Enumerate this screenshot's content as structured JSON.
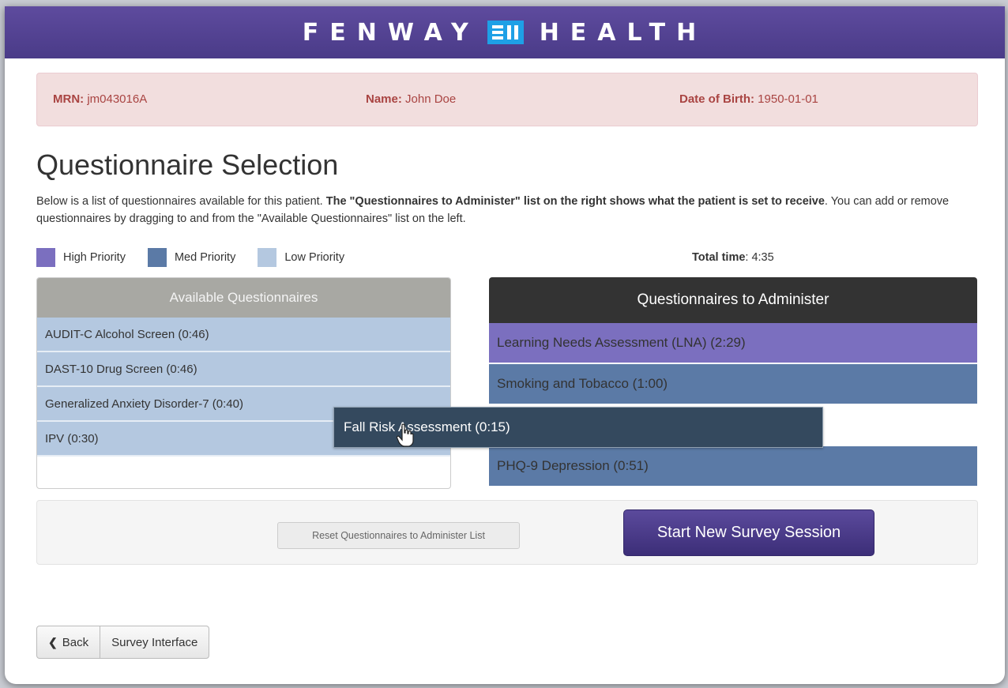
{
  "header": {
    "logo_left": "FENWAY",
    "logo_right": "HEALTH"
  },
  "patient": {
    "mrn_label": "MRN:",
    "mrn_value": "jm043016A",
    "name_label": "Name:",
    "name_value": "John Doe",
    "dob_label": "Date of Birth:",
    "dob_value": "1950-01-01"
  },
  "page": {
    "title": "Questionnaire Selection",
    "desc_1": "Below is a list of questionnaires available for this patient. ",
    "desc_bold": "The \"Questionnaires to Administer\" list on the right shows what the patient is set to receive",
    "desc_2": ". You can add or remove questionnaires by dragging to and from the \"Available Questionnaires\" list on the left."
  },
  "legend": {
    "high": "High Priority",
    "med": "Med Priority",
    "low": "Low Priority",
    "colors": {
      "high": "#7b6fbf",
      "med": "#5b7aa6",
      "low": "#b4c8e0"
    }
  },
  "total_time": {
    "label": "Total time",
    "value": ": 4:35"
  },
  "available": {
    "title": "Available Questionnaires",
    "items": [
      "AUDIT-C Alcohol Screen (0:46)",
      "DAST-10 Drug Screen (0:46)",
      "Generalized Anxiety Disorder-7 (0:40)",
      "IPV (0:30)"
    ]
  },
  "administer": {
    "title": "Questionnaires to Administer",
    "items": [
      "Learning Needs Assessment (LNA) (2:29)",
      "Smoking and Tobacco (1:00)",
      "",
      "PHQ-9 Depression (0:51)"
    ]
  },
  "dragging": {
    "label": "Fall Risk Assessment (0:15)"
  },
  "actions": {
    "reset_label": "Reset Questionnaires to Administer List",
    "start_label": "Start New Survey Session"
  },
  "nav": {
    "back_label": "Back",
    "survey_label": "Survey Interface"
  }
}
